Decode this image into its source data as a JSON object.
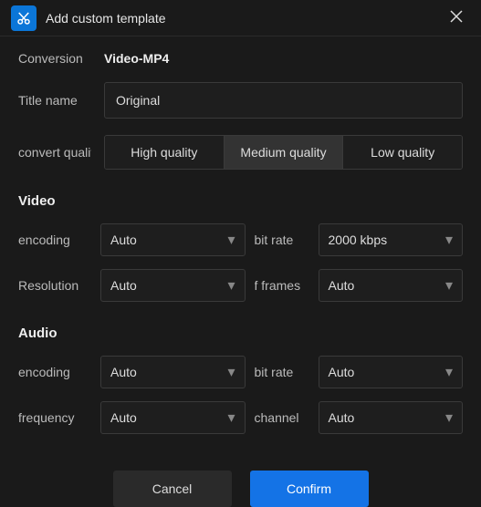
{
  "window": {
    "title": "Add custom template"
  },
  "conversion": {
    "label": "Conversion",
    "value": "Video-MP4"
  },
  "title_name": {
    "label": "Title name",
    "value": "Original"
  },
  "quality": {
    "label": "convert quality",
    "options": [
      "High quality",
      "Medium quality",
      "Low quality"
    ],
    "selected": 1
  },
  "video": {
    "heading": "Video",
    "encoding": {
      "label": "encoding",
      "value": "Auto"
    },
    "bitrate": {
      "label": "bit rate",
      "value": "2000 kbps"
    },
    "resolution": {
      "label": "Resolution",
      "value": "Auto"
    },
    "frames": {
      "label": "f frames",
      "value": "Auto"
    }
  },
  "audio": {
    "heading": "Audio",
    "encoding": {
      "label": "encoding",
      "value": "Auto"
    },
    "bitrate": {
      "label": "bit rate",
      "value": "Auto"
    },
    "frequency": {
      "label": "frequency",
      "value": "Auto"
    },
    "channel": {
      "label": "channel",
      "value": "Auto"
    }
  },
  "footer": {
    "cancel": "Cancel",
    "confirm": "Confirm"
  }
}
